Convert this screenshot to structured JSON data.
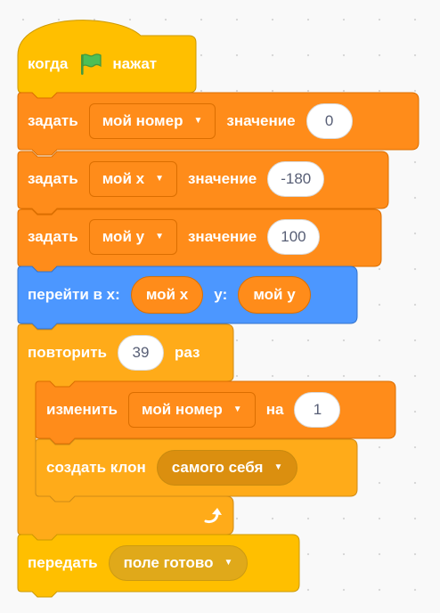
{
  "colors": {
    "events": "#ffbf00",
    "variables": "#ff8c1a",
    "motion": "#4c97ff",
    "control": "#ffab19",
    "flag": "#4cbf56"
  },
  "blocks": {
    "when_flag": {
      "text_before": "когда",
      "icon": "green-flag-icon",
      "text_after": "нажат"
    },
    "set_number": {
      "label": "задать",
      "variable": "мой номер",
      "value_label": "значение",
      "value": "0"
    },
    "set_x": {
      "label": "задать",
      "variable": "мой x",
      "value_label": "значение",
      "value": "-180"
    },
    "set_y": {
      "label": "задать",
      "variable": "мой y",
      "value_label": "значение",
      "value": "100"
    },
    "goto": {
      "label": "перейти в x:",
      "x_reporter": "мой x",
      "y_label": "y:",
      "y_reporter": "мой y"
    },
    "repeat": {
      "label": "повторить",
      "count": "39",
      "label_after": "раз",
      "loop_icon": "loop-arrow-icon"
    },
    "change_number": {
      "label": "изменить",
      "variable": "мой номер",
      "by_label": "на",
      "value": "1"
    },
    "create_clone": {
      "label": "создать клон",
      "target": "самого себя"
    },
    "broadcast": {
      "label": "передать",
      "message": "поле готово"
    }
  }
}
